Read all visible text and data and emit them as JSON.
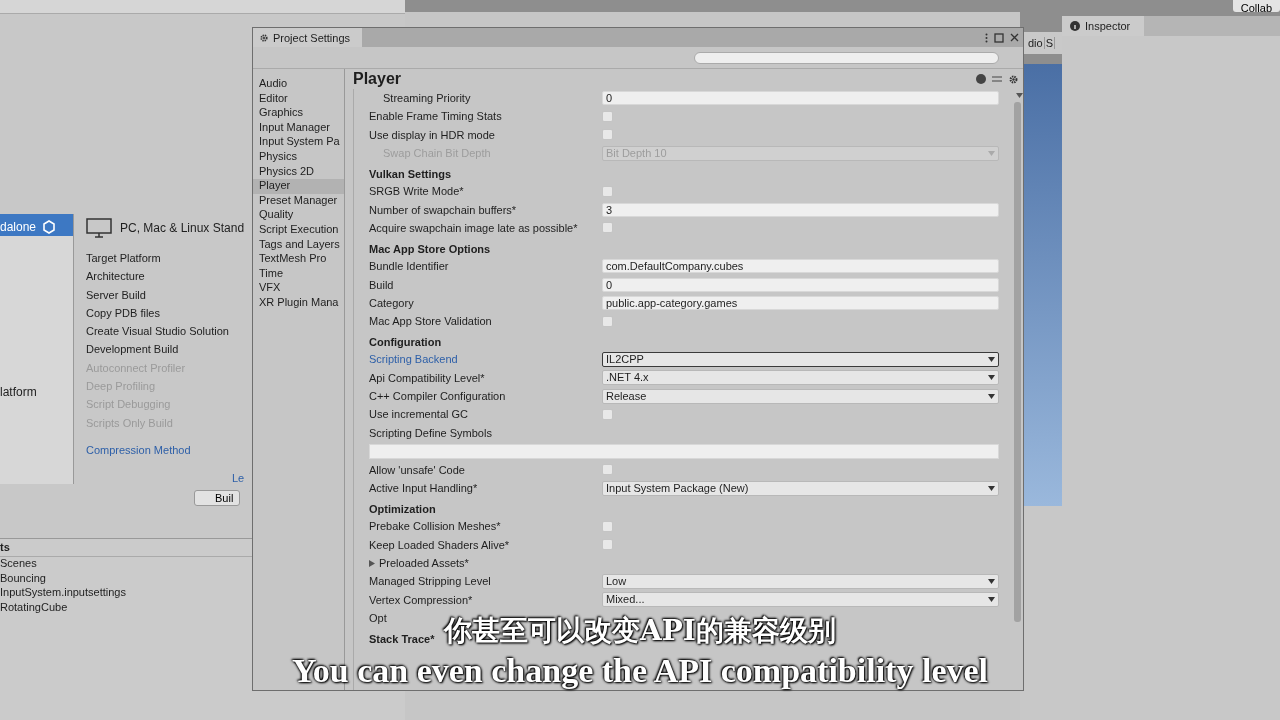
{
  "toolbar": {
    "collab": "Collab"
  },
  "build_settings": {
    "platforms": [
      {
        "label": "dalone",
        "selected": true
      },
      {
        "label": "latform",
        "selected": false
      }
    ],
    "platform_title": "PC, Mac & Linux Stand",
    "options": [
      {
        "label": "Target Platform",
        "kind": "plain"
      },
      {
        "label": "Architecture",
        "kind": "plain"
      },
      {
        "label": "Server Build",
        "kind": "plain"
      },
      {
        "label": "Copy PDB files",
        "kind": "plain"
      },
      {
        "label": "Create Visual Studio Solution",
        "kind": "plain"
      },
      {
        "label": "Development Build",
        "kind": "plain"
      },
      {
        "label": "Autoconnect Profiler",
        "kind": "disabled"
      },
      {
        "label": "Deep Profiling",
        "kind": "disabled"
      },
      {
        "label": "Script Debugging",
        "kind": "disabled"
      },
      {
        "label": "Scripts Only Build",
        "kind": "disabled"
      },
      {
        "label": "Compression Method",
        "kind": "link"
      }
    ],
    "link": "Le",
    "build_button": "Buil"
  },
  "project_panel": {
    "title": "ts",
    "items": [
      "Scenes",
      "Bouncing",
      "InputSystem.inputsettings",
      "RotatingCube"
    ]
  },
  "scene_tabs": [
    "dio",
    "S"
  ],
  "inspector": {
    "title": "Inspector"
  },
  "project_settings": {
    "title": "Project Settings",
    "categories": [
      {
        "label": "Audio",
        "selected": false
      },
      {
        "label": "Editor",
        "selected": false
      },
      {
        "label": "Graphics",
        "selected": false
      },
      {
        "label": "Input Manager",
        "selected": false
      },
      {
        "label": "Input System Pa",
        "selected": false
      },
      {
        "label": "Physics",
        "selected": false
      },
      {
        "label": "Physics 2D",
        "selected": false
      },
      {
        "label": "Player",
        "selected": true
      },
      {
        "label": "Preset Manager",
        "selected": false
      },
      {
        "label": "Quality",
        "selected": false
      },
      {
        "label": "Script Execution",
        "selected": false
      },
      {
        "label": "Tags and Layers",
        "selected": false
      },
      {
        "label": "TextMesh Pro",
        "selected": false
      },
      {
        "label": "Time",
        "selected": false
      },
      {
        "label": "VFX",
        "selected": false
      },
      {
        "label": "XR Plugin Mana",
        "selected": false
      }
    ],
    "heading": "Player",
    "rows": [
      {
        "kind": "text",
        "label": "Streaming Priority",
        "value": "0",
        "indented": true
      },
      {
        "kind": "checkbox",
        "label": "Enable Frame Timing Stats",
        "checked": false
      },
      {
        "kind": "checkbox",
        "label": "Use display in HDR mode",
        "checked": false
      },
      {
        "kind": "dropdown",
        "label": "Swap Chain Bit Depth",
        "value": "Bit Depth 10",
        "indented": true,
        "disabled": true
      },
      {
        "kind": "header",
        "label": "Vulkan Settings"
      },
      {
        "kind": "checkbox",
        "label": "SRGB Write Mode*",
        "checked": false
      },
      {
        "kind": "text",
        "label": "Number of swapchain buffers*",
        "value": "3"
      },
      {
        "kind": "checkbox",
        "label": "Acquire swapchain image late as possible*",
        "checked": false
      },
      {
        "kind": "header",
        "label": "Mac App Store Options"
      },
      {
        "kind": "text",
        "label": "Bundle Identifier",
        "value": "com.DefaultCompany.cubes"
      },
      {
        "kind": "text",
        "label": "Build",
        "value": "0"
      },
      {
        "kind": "text",
        "label": "Category",
        "value": "public.app-category.games"
      },
      {
        "kind": "checkbox",
        "label": "Mac App Store Validation",
        "checked": false
      },
      {
        "kind": "header",
        "label": "Configuration"
      },
      {
        "kind": "dropdown",
        "label": "Scripting Backend",
        "value": "IL2CPP",
        "link": true,
        "focused": true
      },
      {
        "kind": "dropdown",
        "label": "Api Compatibility Level*",
        "value": ".NET 4.x"
      },
      {
        "kind": "dropdown",
        "label": "C++ Compiler Configuration",
        "value": "Release"
      },
      {
        "kind": "checkbox",
        "label": "Use incremental GC",
        "checked": false
      },
      {
        "kind": "widetext",
        "label": "Scripting Define Symbols"
      },
      {
        "kind": "checkbox",
        "label": "Allow 'unsafe' Code",
        "checked": false
      },
      {
        "kind": "dropdown",
        "label": "Active Input Handling*",
        "value": "Input System Package (New)"
      },
      {
        "kind": "header",
        "label": "Optimization"
      },
      {
        "kind": "checkbox",
        "label": "Prebake Collision Meshes*",
        "checked": false
      },
      {
        "kind": "checkbox",
        "label": "Keep Loaded Shaders Alive*",
        "checked": false
      },
      {
        "kind": "foldout",
        "label": "Preloaded Assets*",
        "expanded": false
      },
      {
        "kind": "dropdown",
        "label": "Managed Stripping Level",
        "value": "Low"
      },
      {
        "kind": "dropdown",
        "label": "Vertex Compression*",
        "value": "Mixed..."
      },
      {
        "kind": "plain",
        "label": "Opt"
      },
      {
        "kind": "header",
        "label": "Stack Trace*"
      }
    ]
  },
  "subtitles": {
    "chinese": "你甚至可以改变API的兼容级别",
    "english": "You can even change the API compatibility level"
  }
}
